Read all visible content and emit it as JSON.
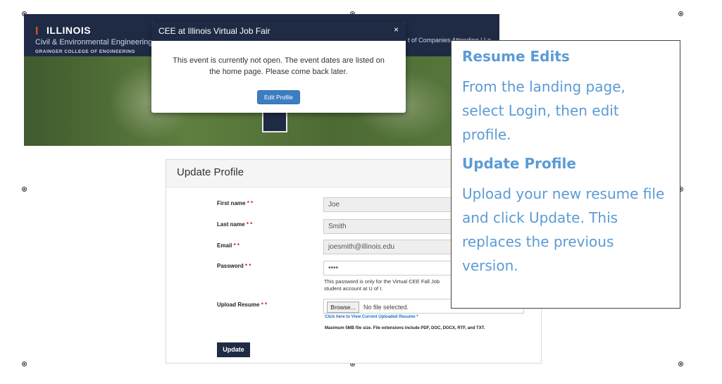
{
  "banner": {
    "logo_mark": "I",
    "logo_title": "ILLINOIS",
    "department": "Civil & Environmental Engineering",
    "college": "GRAINGER COLLEGE OF ENGINEERING",
    "nav_right": "t of Companies Attending  |  Lo"
  },
  "modal": {
    "title": "CEE at Illinois Virtual Job Fair",
    "close": "×",
    "message_line1": "This event is currently not open. The event dates are listed on",
    "message_line2": "the home page. Please come back later.",
    "button": "Edit Profile"
  },
  "profile": {
    "title": "Update Profile",
    "required_mark": "* *",
    "fields": {
      "first_name": {
        "label": "First name",
        "value": "Joe"
      },
      "last_name": {
        "label": "Last name",
        "value": "Smith"
      },
      "email": {
        "label": "Email",
        "value": "joesmith@illinois.edu"
      },
      "password": {
        "label": "Password",
        "value": "••••"
      },
      "upload_resume": {
        "label": "Upload Resume"
      }
    },
    "password_hint_line1": "This password is only for the Virtual CEE Fall Job",
    "password_hint_line2": "student account at U of I.",
    "browse_button": "Browse...",
    "file_status": "No file selected.",
    "resume_link": "Click here to View Current Uploaded Resume *",
    "max_size_note": "Maximum 5MB file size. File extensions include PDF, DOC, DOCX, RTF, and TXT.",
    "update_button": "Update"
  },
  "callout": {
    "heading1": "Resume Edits",
    "para1": "From the landing page, select Login, then edit profile.",
    "heading2": "Update Profile",
    "para2": "Upload your new resume file and click Update. This replaces the previous version."
  },
  "colors": {
    "navy": "#1f2b45",
    "illinois_orange": "#e84a27",
    "callout_text": "#5b9bd5",
    "edit_button": "#3d7ec2"
  }
}
